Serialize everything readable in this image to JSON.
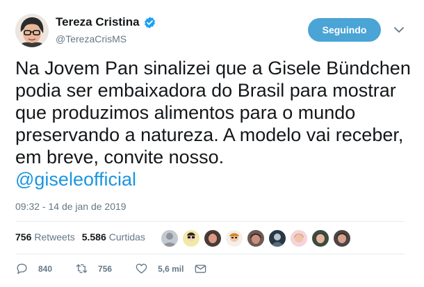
{
  "user": {
    "display_name": "Tereza Cristina",
    "handle": "@TerezaCrisMS",
    "follow_label": "Seguindo",
    "accent": "#1da1f2"
  },
  "tweet": {
    "text": "Na Jovem Pan sinalizei que a Gisele Bündchen podia ser embaixadora do Brasil para mostrar que produzimos alimentos para o mundo preservando a natureza. A modelo vai receber, em breve, convite nosso.",
    "mention": "@giseleofficial",
    "timestamp": "09:32 - 14 de jan de 2019"
  },
  "stats": {
    "retweets_count": "756",
    "retweets_label": "Retweets",
    "likes_count": "5.586",
    "likes_label": "Curtidas"
  },
  "actions": {
    "replies": "840",
    "retweets": "756",
    "likes": "5,6 mil"
  },
  "icons": [
    "verified-icon",
    "chevron-down-icon",
    "reply-icon",
    "retweet-icon",
    "heart-icon",
    "message-icon"
  ]
}
